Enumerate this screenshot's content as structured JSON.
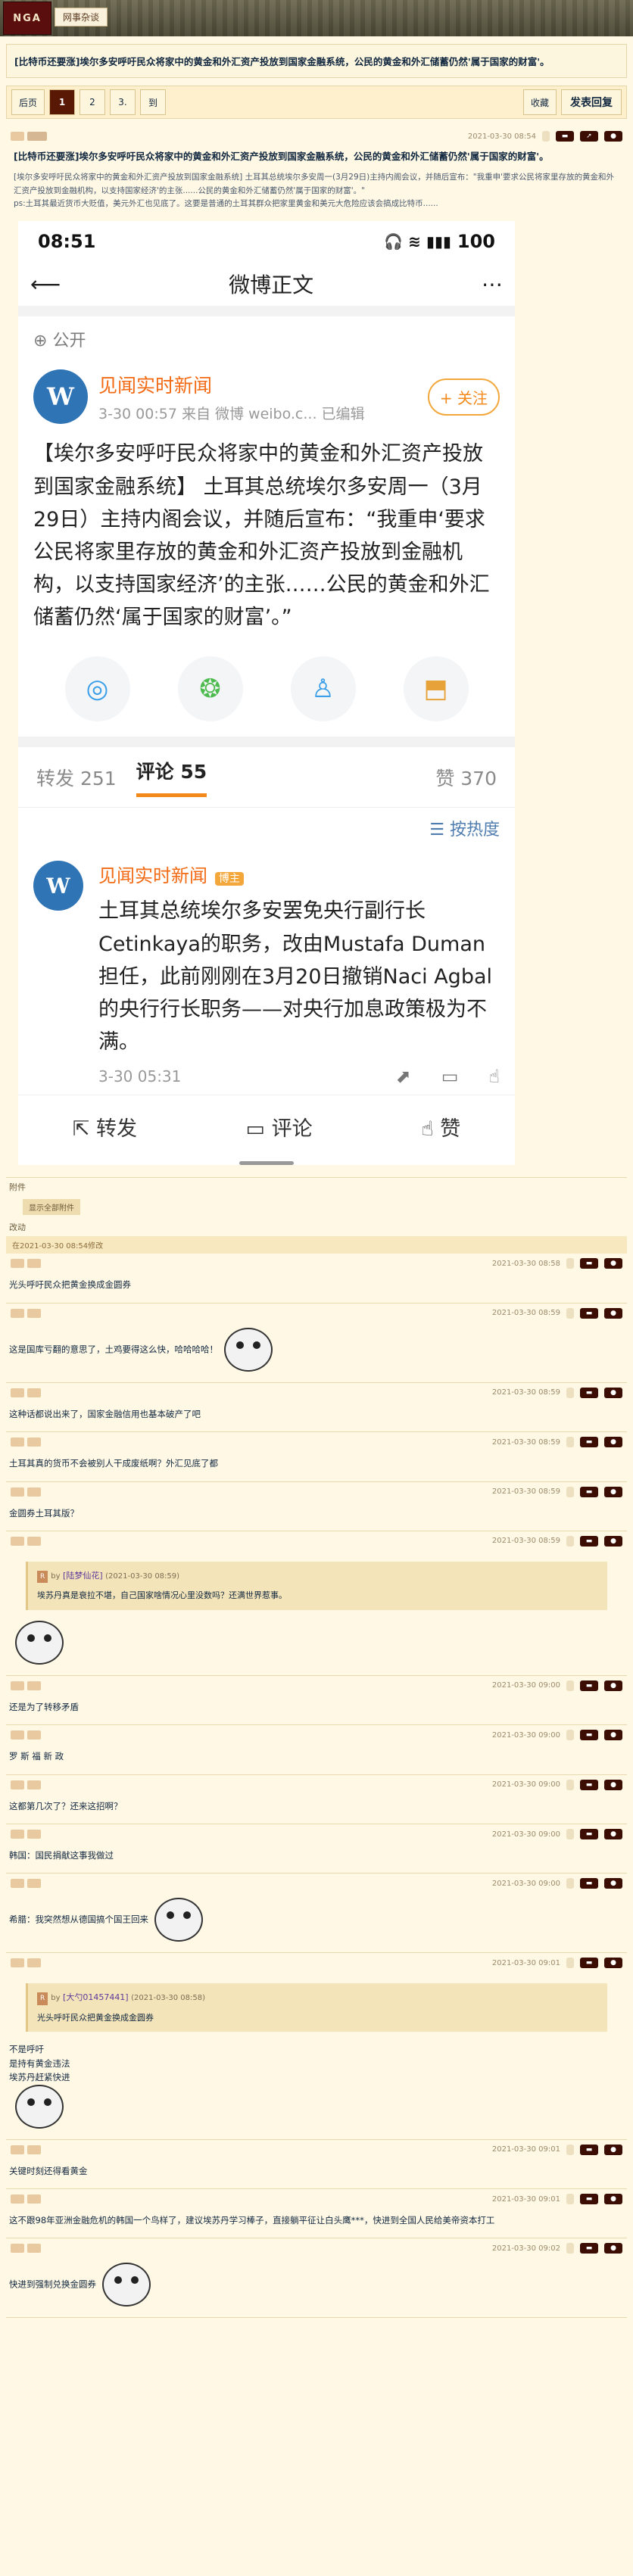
{
  "header": {
    "logo": "NGA",
    "forum": "网事杂谈"
  },
  "topic_title": "[比特币还要涨]埃尔多安呼吁民众将家中的黄金和外汇资产投放到国家金融系统，公民的黄金和外汇储蓄仍然'属于国家的财富'。",
  "nav": {
    "back": "后页",
    "pages": [
      "1",
      "2",
      "3.",
      "到"
    ],
    "fav": "收藏",
    "reply": "发表回复"
  },
  "op": {
    "time": "2021-03-30 08:54",
    "title": "[比特币还要涨]埃尔多安呼吁民众将家中的黄金和外汇资产投放到国家金融系统，公民的黄金和外汇储蓄仍然'属于国家的财富'。",
    "lead": "[埃尔多安呼吁民众将家中的黄金和外汇资产投放到国家金融系统] 土耳其总统埃尔多安周一(3月29日)主持内阁会议，并随后宣布：\"我重申'要求公民将家里存放的黄金和外汇资产投放到金融机构，以支持国家经济'的主张......公民的黄金和外汇储蓄仍然'属于国家的财富'。\"",
    "ps": "ps:土耳其最近货币大贬值，美元外汇也见底了。这要是普通的土耳其群众把家里黄金和美元大危险应该会搞成比特币......",
    "weibo": {
      "status_time": "08:51",
      "status_battery": "100",
      "nav_title": "微博正文",
      "public": "公开",
      "user": "见闻实时新闻",
      "meta": "3-30 00:57  来自 微博 weibo.c...   已编辑",
      "follow": "+ 关注",
      "text": "【埃尔多安呼吁民众将家中的黄金和外汇资产投放到国家金融系统】 土耳其总统埃尔多安周一（3月29日）主持内阁会议，并随后宣布：“我重申‘要求公民将家里存放的黄金和外汇资产投放到金融机构，以支持国家经济’的主张……公民的黄金和外汇储蓄仍然‘属于国家的财富’。”",
      "tabs": {
        "repost": "转发 251",
        "comment": "评论 55",
        "like": "赞 370"
      },
      "sort": "按热度",
      "comment": {
        "user": "见闻实时新闻",
        "badge": "博主",
        "text": "土耳其总统埃尔多安罢免央行副行长Cetinkaya的职务，改由Mustafa Duman担任，此前刚刚在3月20日撤销Naci Agbal的央行行长职务——对央行加息政策极为不满。",
        "time": "3-30 05:31"
      },
      "bar": {
        "repost": "转发",
        "comment": "评论",
        "like": "赞"
      }
    }
  },
  "attach": {
    "label": "附件",
    "btn": "显示全部附件"
  },
  "edit": {
    "label": "改动",
    "text": "在2021-03-30 08:54修改"
  },
  "replies": [
    {
      "time": "2021-03-30 08:58",
      "text": "光头呼吁民众把黄金换成金圆券"
    },
    {
      "time": "2021-03-30 08:59",
      "text": "这是国库亏翻的意思了，土鸡要得这么快，哈哈哈哈！"
    },
    {
      "time": "2021-03-30 08:59",
      "text": "这种话都说出来了，国家金融信用也基本破产了吧"
    },
    {
      "time": "2021-03-30 08:59",
      "text": "土耳其真的货币不会被别人干成废纸啊？外汇见底了都"
    },
    {
      "time": "2021-03-30 08:59",
      "text": "金圆券土耳其版？"
    },
    {
      "time": "2021-03-30 08:59",
      "quote": {
        "by": "by",
        "name": "[陆梦仙花]",
        "time": "(2021-03-30 08:59)",
        "text": "埃苏丹真是衰拉不堪，自己国家啥情况心里没数吗？还满世界惹事。"
      }
    },
    {
      "time": "2021-03-30 09:00",
      "text": "还是为了转移矛盾"
    },
    {
      "time": "2021-03-30 09:00",
      "text": "罗 斯 福 新 政"
    },
    {
      "time": "2021-03-30 09:00",
      "text": "这都第几次了？还来这招啊？"
    },
    {
      "time": "2021-03-30 09:00",
      "text": "韩国：国民捐献这事我做过"
    },
    {
      "time": "2021-03-30 09:00",
      "text": "希腊：我突然想从德国搞个国王回来"
    },
    {
      "time": "2021-03-30 09:01",
      "quote": {
        "by": "by",
        "name": "[大勺01457441]",
        "time": "(2021-03-30 08:58)",
        "text": "光头呼吁民众把黄金换成金圆券"
      },
      "after": "不是呼吁\n是持有黄金违法\n埃苏丹赶紧快进"
    },
    {
      "time": "2021-03-30 09:01",
      "text": "关键时刻还得看黄金"
    },
    {
      "time": "2021-03-30 09:01",
      "text": "这不跟98年亚洲金融危机的韩国一个鸟样了，建议埃苏丹学习棒子，直接躺平征让白头鹰***，快进到全国人民给美帝资本打工"
    },
    {
      "time": "2021-03-30 09:02",
      "text": "快进到强制兑换金圆券"
    }
  ]
}
